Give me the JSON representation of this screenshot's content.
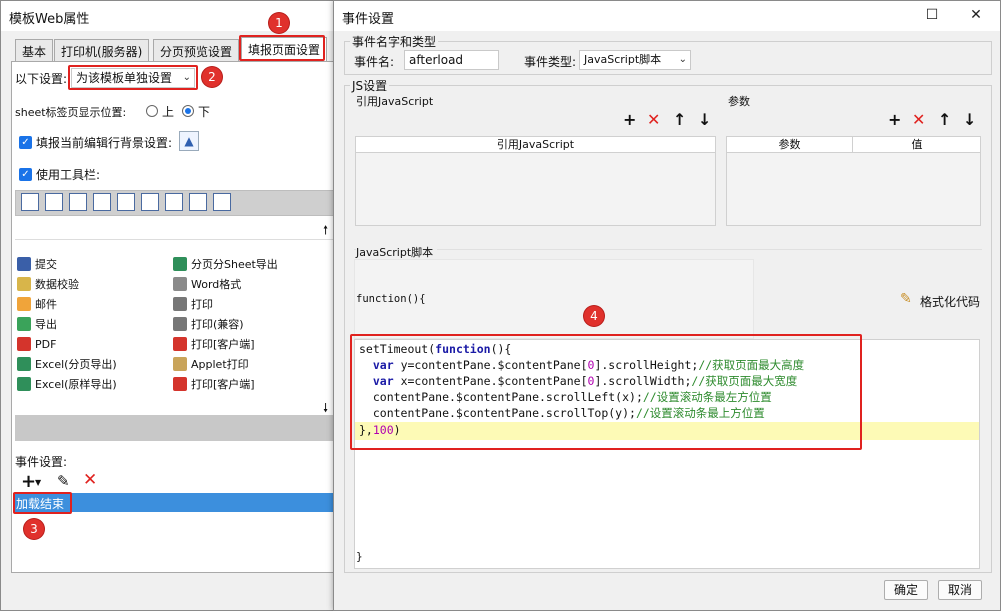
{
  "left_window": {
    "title": "模板Web属性",
    "tabs": [
      "基本",
      "打印机(服务器)",
      "分页预览设置",
      "填报页面设置"
    ],
    "settings_label": "以下设置:",
    "settings_select": "为该模板单独设置",
    "sheet_label": "sheet标签页显示位置:",
    "radio_top": "上",
    "radio_bottom": "下",
    "fill_bg_label": "填报当前编辑行背景设置:",
    "toolbar_label": "使用工具栏:",
    "toolbar_items": {
      "col1": [
        "提交",
        "数据校验",
        "邮件",
        "导出",
        "PDF",
        "Excel(分页导出)",
        "Excel(原样导出)"
      ],
      "col2": [
        "分页分Sheet导出",
        "Word格式",
        "打印",
        "打印(兼容)",
        "打印[客户端]",
        "Applet打印",
        "打印[客户端]"
      ]
    },
    "event_label": "事件设置:",
    "event_item": "加载结束",
    "markers": [
      "1",
      "2",
      "3"
    ]
  },
  "right_window": {
    "title": "事件设置",
    "group_event": "事件名字和类型",
    "event_name_label": "事件名:",
    "event_name_value": "afterload",
    "event_type_label": "事件类型:",
    "event_type_value": "JavaScript脚本",
    "group_js": "JS设置",
    "ref_js_label": "引用JavaScript",
    "ref_js_col": "引用JavaScript",
    "params_label": "参数",
    "params_col1": "参数",
    "params_col2": "值",
    "script_label": "JavaScript脚本",
    "func_header": "function(){",
    "format_code": "格式化代码",
    "closing": "}",
    "ok": "确定",
    "cancel": "取消",
    "marker": "4",
    "code": {
      "l1a": "setTimeout(",
      "l1b": "function",
      "l1c": "(){",
      "l2a": "  ",
      "l2b": "var",
      "l2c": " y=contentPane.$contentPane[",
      "l2d": "0",
      "l2e": "].scrollHeight;",
      "l2f": "//获取页面最大高度",
      "l3a": "  ",
      "l3b": "var",
      "l3c": " x=contentPane.$contentPane[",
      "l3d": "0",
      "l3e": "].scrollWidth;",
      "l3f": "//获取页面最大宽度",
      "l4a": "  contentPane.$contentPane.scrollLeft(x);",
      "l4b": "//设置滚动条最左方位置",
      "l5a": "  contentPane.$contentPane.scrollTop(y);",
      "l5b": "//设置滚动条最上方位置",
      "l6a": "},",
      "l6b": "100",
      "l6c": ")"
    }
  }
}
